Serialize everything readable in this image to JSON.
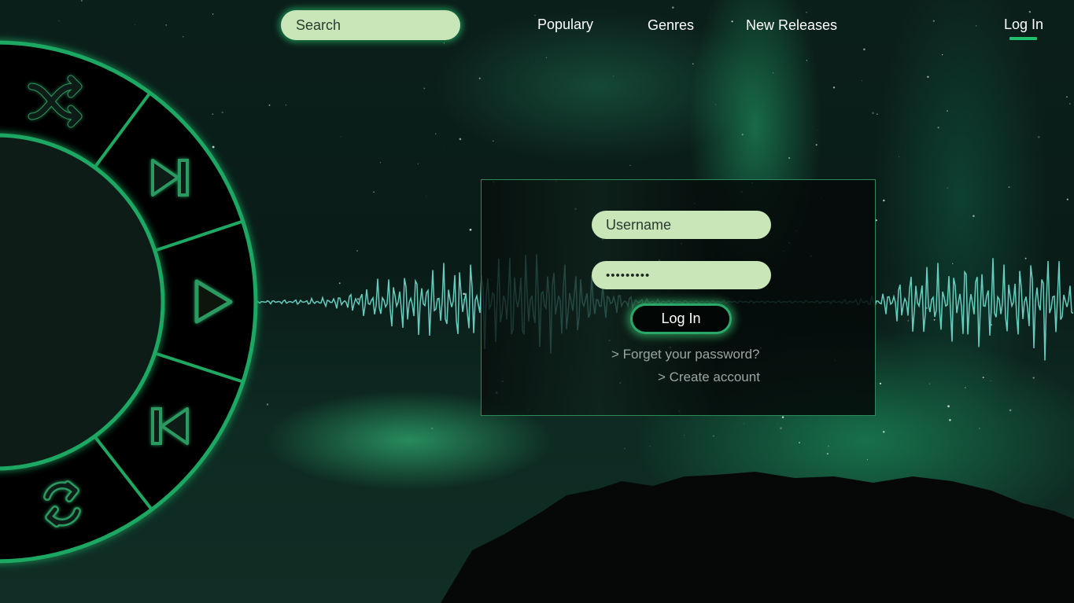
{
  "nav": {
    "search_placeholder": "Search",
    "links": [
      {
        "label": "Populary"
      },
      {
        "label": "Genres"
      },
      {
        "label": "New Releases"
      }
    ],
    "login_label": "Log In"
  },
  "player": {
    "controls": [
      {
        "name": "shuffle",
        "icon": "shuffle-icon"
      },
      {
        "name": "next",
        "icon": "skip-next-icon"
      },
      {
        "name": "play",
        "icon": "play-icon"
      },
      {
        "name": "previous",
        "icon": "skip-previous-icon"
      },
      {
        "name": "repeat",
        "icon": "repeat-icon"
      }
    ]
  },
  "login_form": {
    "username_placeholder": "Username",
    "password_value": "•••••••••",
    "submit_label": "Log In",
    "forgot_link": "> Forget your password?",
    "create_link": "> Create account"
  },
  "colors": {
    "accent": "#1fbf6b",
    "field_bg": "#c9e6b8",
    "waveform": "#6fe0d0"
  }
}
